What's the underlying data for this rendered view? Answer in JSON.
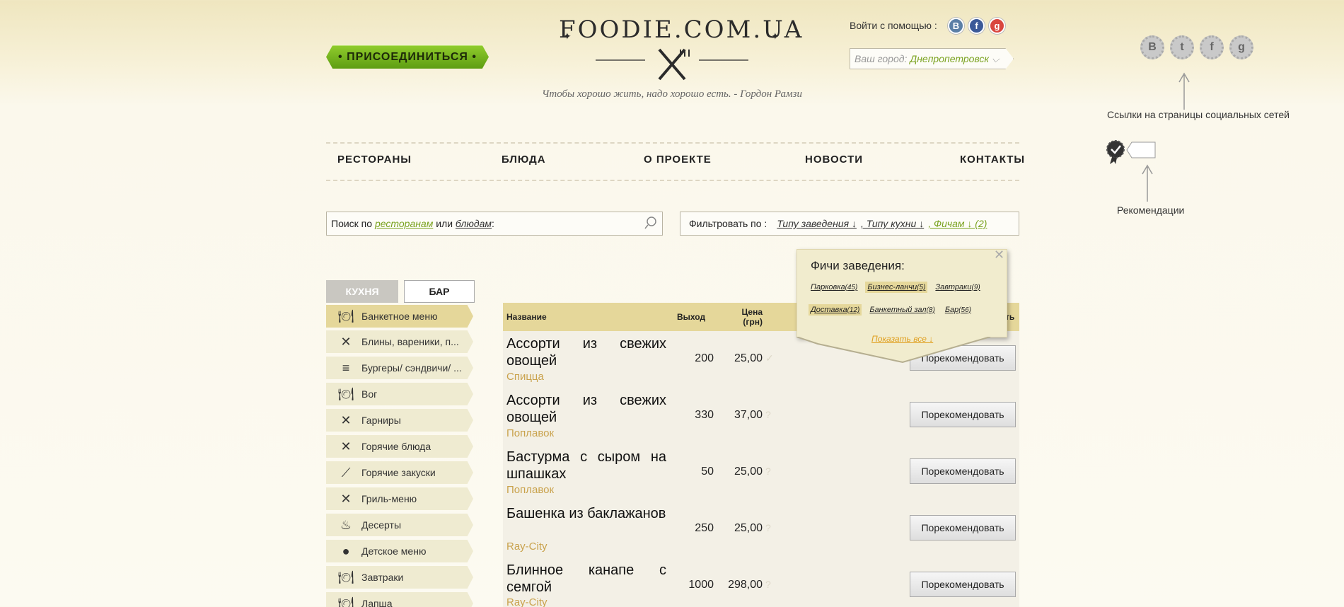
{
  "header": {
    "join_label": "• ПРИСОЕДИНИТЬСЯ •",
    "logo_text": "FOODIE.COM.UA",
    "slogan": "Чтобы хорошо жить, надо хорошо есть. - Гордон Рамзи",
    "login_label": "Войти с помощью :",
    "login_icons": [
      {
        "icon": "vk-icon",
        "glyph": "В",
        "color": "#5b7fa6"
      },
      {
        "icon": "facebook-icon",
        "glyph": "f",
        "color": "#3b5998"
      },
      {
        "icon": "google-plus-icon",
        "glyph": "g",
        "color": "#d9463e"
      }
    ],
    "city_label": "Ваш город:",
    "city_value": "Днепропетровск"
  },
  "nav": [
    "РЕСТОРАНЫ",
    "БЛЮДА",
    "О ПРОЕКТЕ",
    "НОВОСТИ",
    "КОНТАКТЫ"
  ],
  "search": {
    "prefix": "Поиск по",
    "link1": "ресторанам",
    "or": "или",
    "link2": "блюдам",
    "colon": ":"
  },
  "filter": {
    "label": "Фильтровать по :",
    "opt1": "Типу заведения ↓",
    "opt2": ", Типу кухни ↓",
    "opt3": ", Фичам ↓ (2)"
  },
  "tabs": {
    "kitchen": "КУХНЯ",
    "bar": "БАР"
  },
  "sidebar": [
    {
      "label": "Банкетное меню",
      "icon": "plate-icon",
      "glyph": "🍽"
    },
    {
      "label": "Блины, вареники, п...",
      "icon": "cutlery-icon",
      "glyph": "✕"
    },
    {
      "label": "Бургеры/ сэндвичи/ ...",
      "icon": "burger-icon",
      "glyph": "≡"
    },
    {
      "label": "Вог",
      "icon": "plate-icon",
      "glyph": "🍽"
    },
    {
      "label": "Гарниры",
      "icon": "cutlery-icon",
      "glyph": "✕"
    },
    {
      "label": "Горячие блюда",
      "icon": "cutlery-icon",
      "glyph": "✕"
    },
    {
      "label": "Горячие закуски",
      "icon": "skewer-icon",
      "glyph": "⟋"
    },
    {
      "label": "Гриль-меню",
      "icon": "cutlery-icon",
      "glyph": "✕"
    },
    {
      "label": "Десерты",
      "icon": "cupcake-icon",
      "glyph": "♨"
    },
    {
      "label": "Детское меню",
      "icon": "apple-icon",
      "glyph": "●"
    },
    {
      "label": "Завтраки",
      "icon": "plate-icon",
      "glyph": "🍽"
    },
    {
      "label": "Лапша",
      "icon": "plate-icon",
      "glyph": "🍽"
    }
  ],
  "table": {
    "headers": {
      "name": "Название",
      "out": "Выход",
      "price": "Цена (грн)",
      "last": "ть"
    },
    "rec_label": "Порекомендовать",
    "rows": [
      {
        "name": "Ассорти из свежих овощей",
        "restaurant": "Спицца",
        "out": "200",
        "price": "25,00"
      },
      {
        "name": "Ассорти из свежих овощей",
        "restaurant": "Поплавок",
        "out": "330",
        "price": "37,00"
      },
      {
        "name": "Бастурма с сыром на шпашках",
        "restaurant": "Поплавок",
        "out": "50",
        "price": "25,00"
      },
      {
        "name": "Башенка из баклажанов",
        "restaurant": "Ray-City",
        "out": "250",
        "price": "25,00"
      },
      {
        "name": "Блинное канапе с семгой",
        "restaurant": "Ray-City",
        "out": "1000",
        "price": "298,00"
      }
    ]
  },
  "features_popup": {
    "title": "Фичи заведения:",
    "tags": [
      {
        "label": "Парковка",
        "count": "(45)",
        "selected": false
      },
      {
        "label": "Бизнес-ланчи",
        "count": "(5)",
        "selected": true
      },
      {
        "label": "Завтраки",
        "count": "(9)",
        "selected": false
      },
      {
        "label": "Доставка",
        "count": "(12)",
        "selected": true
      },
      {
        "label": "Банкетный зал",
        "count": "(8)",
        "selected": false
      },
      {
        "label": "Бар",
        "count": "(56)",
        "selected": false
      }
    ],
    "show_all": "Показать все ↓"
  },
  "annotations": {
    "social_note": "Ссылки на страницы социальных сетей",
    "rec_note": "Рекомендации",
    "social_icons": [
      {
        "icon": "vk-icon",
        "glyph": "В"
      },
      {
        "icon": "twitter-icon",
        "glyph": "t"
      },
      {
        "icon": "facebook-icon",
        "glyph": "f"
      },
      {
        "icon": "google-plus-icon",
        "glyph": "g"
      }
    ]
  },
  "colors": {
    "accent_green": "#7aa21f",
    "highlight": "#e5d79a",
    "restaurant": "#c9a24c"
  }
}
